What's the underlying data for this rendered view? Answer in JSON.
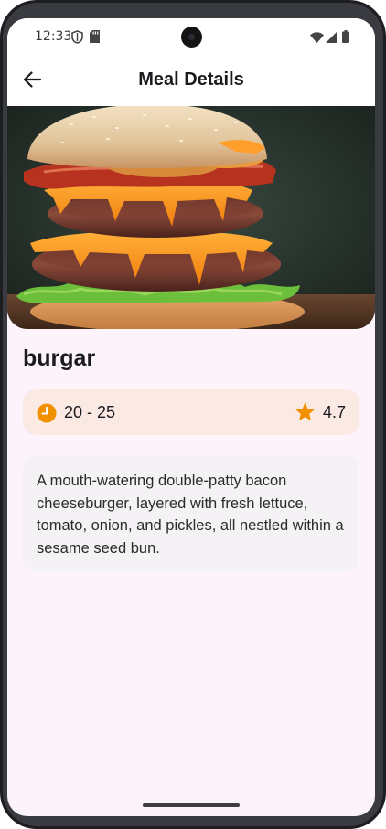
{
  "status_bar": {
    "time": "12:33",
    "icons": [
      "shield-icon",
      "sd-card-icon",
      "wifi-icon",
      "signal-icon",
      "battery-icon"
    ]
  },
  "app_bar": {
    "title": "Meal Details",
    "back_icon": "arrow-left-icon"
  },
  "meal": {
    "name": "burgar",
    "time": "20 - 25",
    "rating": "4.7",
    "description": "A mouth-watering double-patty bacon cheeseburger, layered with fresh lettuce, tomato, onion, and pickles, all nestled within a sesame seed bun."
  },
  "colors": {
    "accent": "#f29100",
    "info_card_bg": "#fbe9e4",
    "desc_card_bg": "#f4f2f4",
    "screen_bg": "#fdf3fb"
  }
}
